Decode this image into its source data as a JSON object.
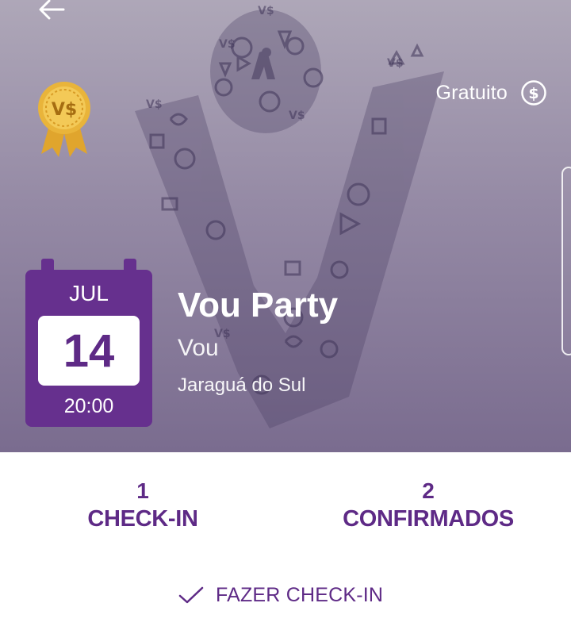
{
  "header": {
    "back_icon": "arrow-left-icon",
    "badge_icon": "vs-award-ribbon-icon",
    "badge_text": "V$",
    "price_label": "Gratuito",
    "price_icon": "dollar-circle-icon"
  },
  "event": {
    "month": "JUL",
    "day": "14",
    "time": "20:00",
    "title": "Vou Party",
    "organizer": "Vou",
    "city": "Jaraguá do Sul"
  },
  "stats": {
    "checkin_count": "1",
    "checkin_label": "CHECK-IN",
    "confirmed_count": "2",
    "confirmed_label": "CONFIRMADOS"
  },
  "action": {
    "checkin_button_label": "FAZER CHECK-IN",
    "checkin_icon": "check-icon"
  },
  "colors": {
    "brand_purple": "#66308e",
    "text_purple": "#5e2a86",
    "hero_top": "#aea7b8",
    "hero_bottom": "#7a6c8f",
    "badge_gold": "#e9b43a"
  }
}
